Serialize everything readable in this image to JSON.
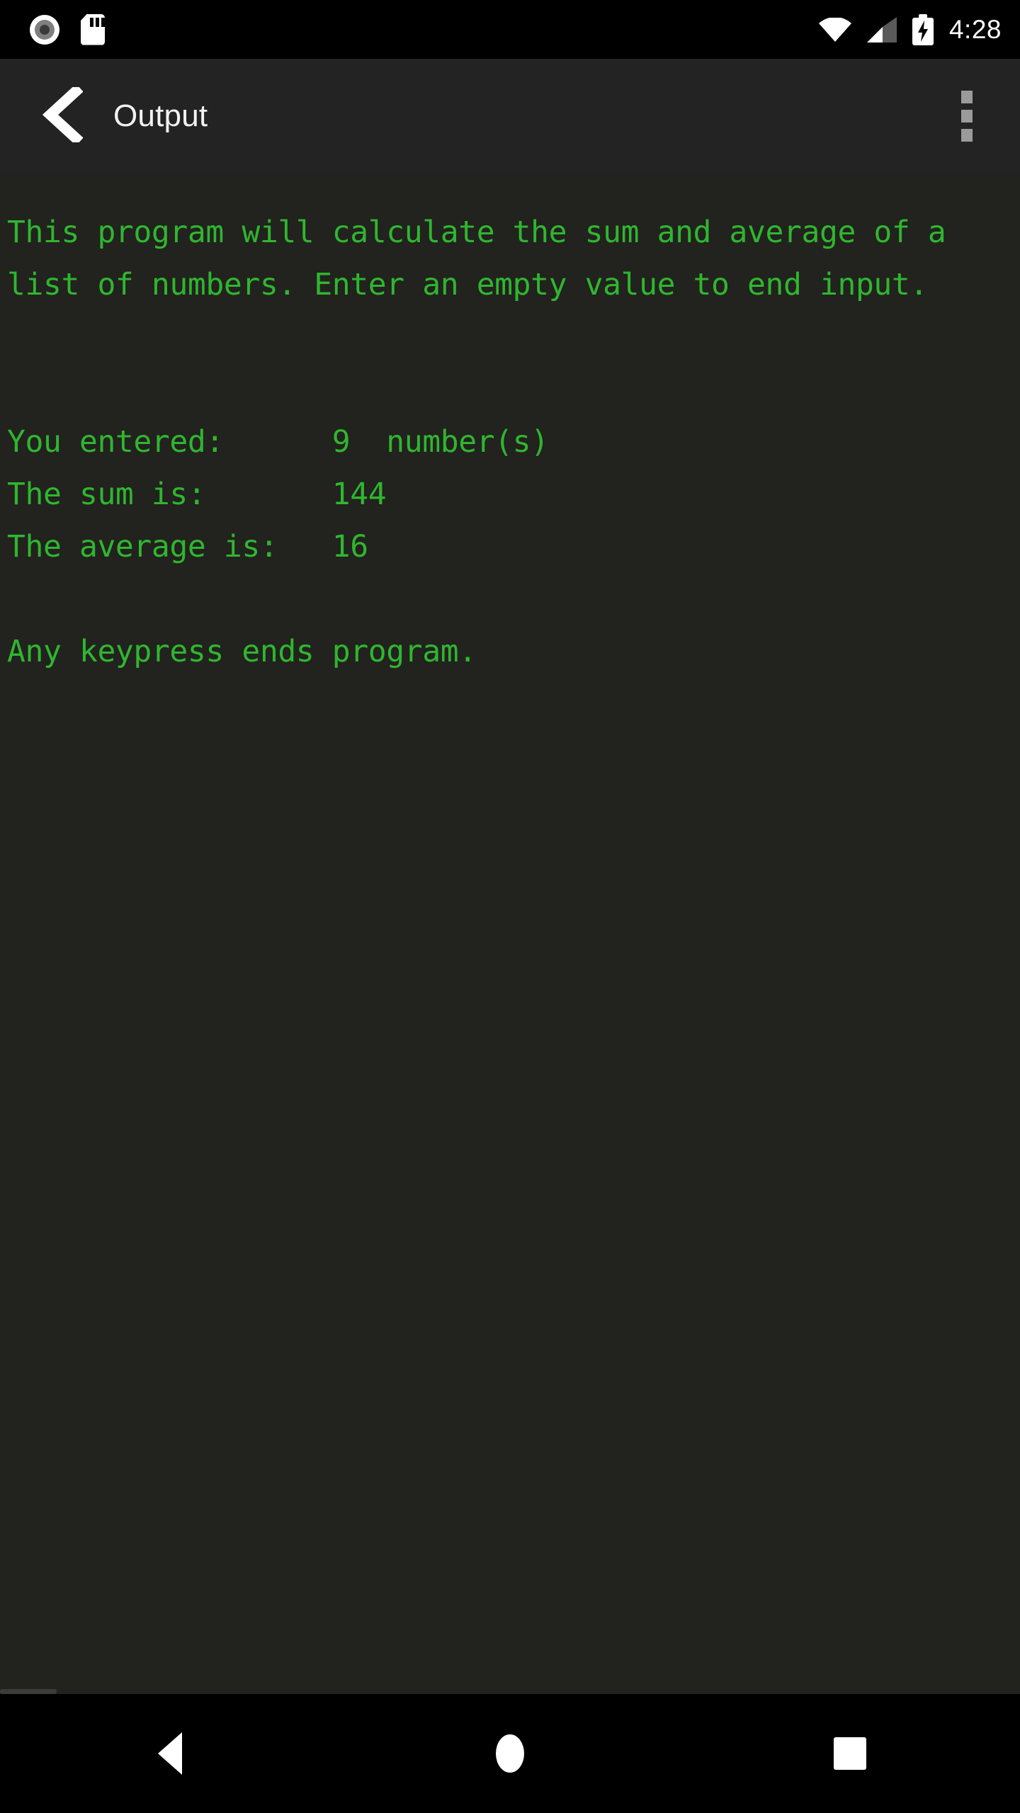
{
  "status_bar": {
    "icons_left": [
      "record-circle-icon",
      "sd-card-icon"
    ],
    "icons_right": [
      "wifi-icon",
      "cellular-signal-icon",
      "battery-charging-icon"
    ],
    "time": "4:28",
    "background_color": "#000000"
  },
  "app_bar": {
    "back_icon": "chevron-left-icon",
    "title": "Output",
    "overflow_icon": "kebab-menu-icon",
    "background_color": "#232323",
    "title_color": "#f2f2f2"
  },
  "terminal": {
    "background_color": "#22221e",
    "text_color": "#2fb62f",
    "lines": [
      "This program will calculate the sum and average of a",
      "list of numbers. Enter an empty value to end input.",
      "",
      "",
      "You entered:      9  number(s)",
      "The sum is:       144",
      "The average is:   16",
      "",
      "Any keypress ends program."
    ],
    "output_values": {
      "count_label": "You entered:",
      "count_value": "9",
      "count_unit": "number(s)",
      "sum_label": "The sum is:",
      "sum_value": "144",
      "average_label": "The average is:",
      "average_value": "16",
      "exit_message": "Any keypress ends program."
    },
    "horizontally_clipped": true
  },
  "nav_bar": {
    "background_color": "#000000",
    "buttons": [
      {
        "name": "back",
        "icon": "triangle-back-icon"
      },
      {
        "name": "home",
        "icon": "circle-home-icon"
      },
      {
        "name": "recents",
        "icon": "square-recents-icon"
      }
    ]
  }
}
